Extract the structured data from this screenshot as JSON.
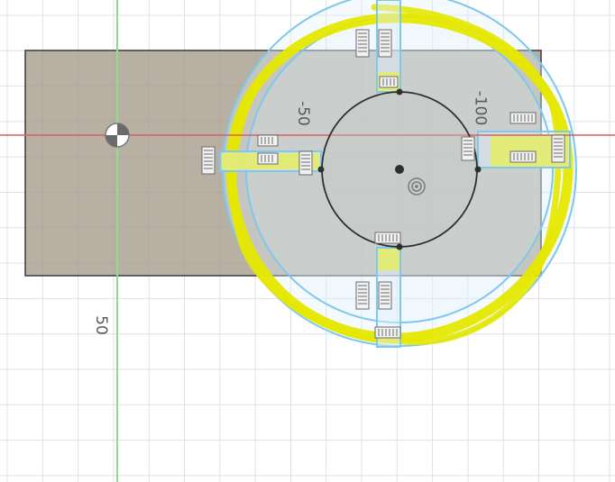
{
  "viewport": {
    "background": "#ffffff",
    "grid_color": "#dde1e6",
    "axes": {
      "x_axis_color": "#d9605f",
      "y_axis_color": "#8fdc8f"
    }
  },
  "sketch": {
    "rectangle_fill": "#a79f8f",
    "rectangle_stroke": "#3a3a3a",
    "profile_fill": "#dff0fb",
    "profile_stroke": "#7ec8ea",
    "highlight_color": "#e5e800",
    "circle_stroke": "#2f2f2f"
  },
  "dimension_labels": {
    "neg50": "-50",
    "neg100": "-100",
    "pos50": "50"
  },
  "icons": [
    "origin-marker-icon",
    "center-point-icon",
    "sketch-point-icon",
    "horizontal-constraint-icon",
    "vertical-constraint-icon"
  ]
}
